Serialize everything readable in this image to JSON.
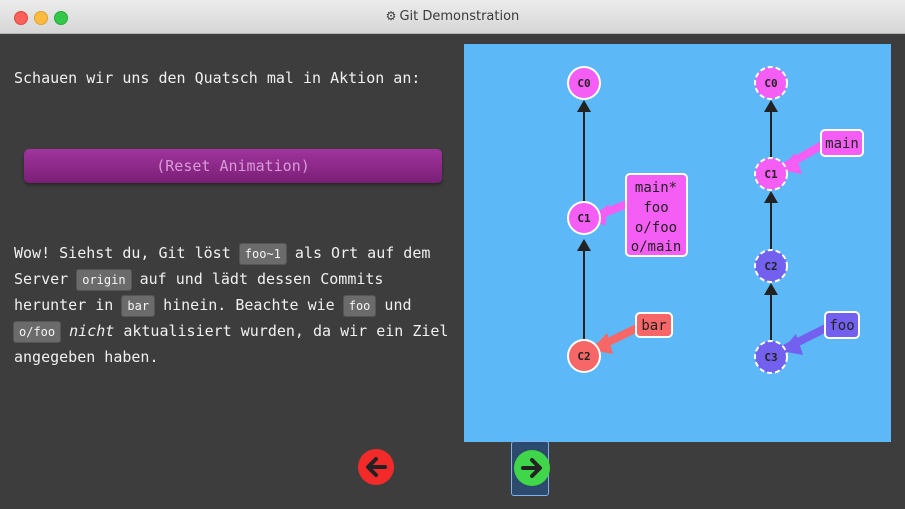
{
  "window": {
    "title": "Git Demonstration",
    "title_icon": "gear-icon"
  },
  "left": {
    "intro": "Schauen wir uns den Quatsch mal in Aktion an:",
    "reset_label": "(Reset Animation)",
    "explain": {
      "p1": "Wow! Siehst du, Git löst ",
      "c1": "foo~1",
      "p2": " als Ort auf dem Server ",
      "c2": "origin",
      "p3": " auf und lädt dessen Commits herunter in ",
      "c3": "bar",
      "p4": " hinein. Beachte wie ",
      "c4": "foo",
      "p5": " und ",
      "c5": "o/foo",
      "p6": " ",
      "em": "nicht",
      "p7": " aktualisiert wurden, da wir ein Ziel angegeben haben."
    }
  },
  "viz": {
    "colors": {
      "background": "#5cb8f7",
      "pink": "#f55ef4",
      "red": "#f76767",
      "purple": "#7360ef"
    },
    "local": {
      "commits": [
        "C0",
        "C1",
        "C2"
      ],
      "labels": {
        "c1": [
          "main*",
          "foo",
          "o/foo",
          "o/main"
        ],
        "c2": "bar"
      }
    },
    "remote": {
      "commits": [
        "C0",
        "C1",
        "C2",
        "C3"
      ],
      "labels": {
        "c1": "main",
        "c3": "foo"
      }
    }
  },
  "nav": {
    "back_icon": "arrow-left-icon",
    "forward_icon": "arrow-right-icon"
  }
}
